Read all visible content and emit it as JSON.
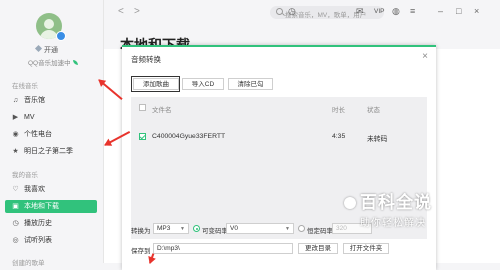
{
  "sidebar": {
    "user_status": "开通",
    "accel_label": "QQ音乐加速中",
    "section_online": "在线音乐",
    "online_items": [
      {
        "icon": "music-note-icon",
        "glyph": "♫",
        "label": "音乐馆"
      },
      {
        "icon": "mv-icon",
        "glyph": "▶",
        "label": "MV"
      },
      {
        "icon": "radio-icon",
        "glyph": "◉",
        "label": "个性电台"
      },
      {
        "icon": "star-icon",
        "glyph": "★",
        "label": "明日之子第二季"
      }
    ],
    "section_mine": "我的音乐",
    "mine_items": [
      {
        "icon": "heart-icon",
        "glyph": "♡",
        "label": "我喜欢"
      },
      {
        "icon": "download-icon",
        "glyph": "▣",
        "label": "本地和下载",
        "active": true
      },
      {
        "icon": "clock-icon",
        "glyph": "◷",
        "label": "播放历史"
      },
      {
        "icon": "headphone-icon",
        "glyph": "◎",
        "label": "试听列表"
      }
    ],
    "section_created": "创建的歌单"
  },
  "topbar": {
    "back_glyph": "<",
    "forward_glyph": ">",
    "search_placeholder": "搜索音乐，MV，歌单，用户",
    "vip_label": "VIP"
  },
  "page": {
    "title": "本地和下载"
  },
  "dialog": {
    "title": "音频转换",
    "close_glyph": "×",
    "buttons": {
      "add": "添加歌曲",
      "import_cd": "导入CD",
      "clear_checked": "清除已勾"
    },
    "list": {
      "col_filename": "文件名",
      "col_duration": "时长",
      "col_status": "状态",
      "rows": [
        {
          "checked": true,
          "filename": "C400004Gyue33FERTT",
          "duration": "4:35",
          "status": "未转码"
        }
      ]
    },
    "convert_label": "转换为",
    "format_value": "MP3",
    "vbr_label": "可变码率",
    "vbr_value": "V0",
    "cbr_label": "恒定码率",
    "cbr_value": "320",
    "save_label": "保存到",
    "save_path": "D:\\mp3\\",
    "change_dir_button": "更改目录",
    "open_folder_button": "打开文件夹"
  },
  "watermark": {
    "big": "百科全说",
    "small": "助你轻松解决"
  },
  "colors": {
    "accent": "#31c27c",
    "arrow": "#e8332c"
  }
}
